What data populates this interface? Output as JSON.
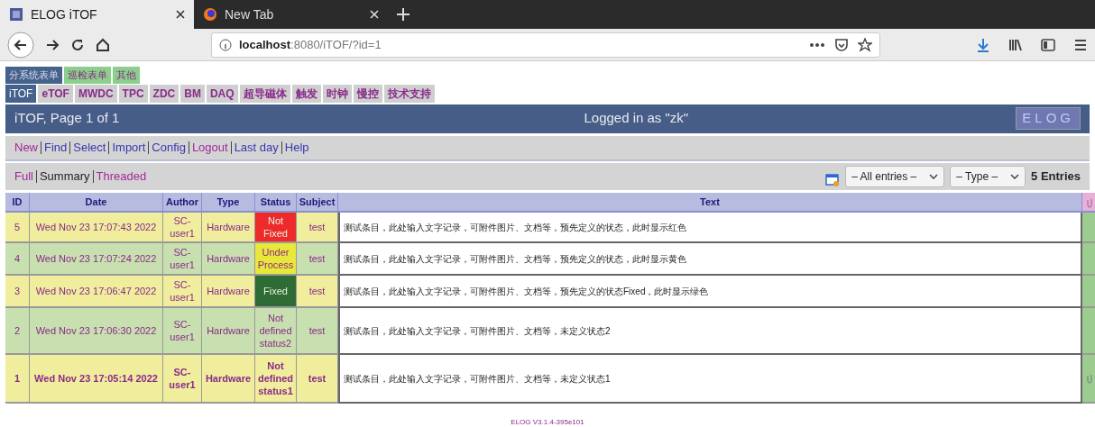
{
  "browser": {
    "tabs": [
      {
        "title": "ELOG iTOF",
        "selected": true
      },
      {
        "title": "New Tab",
        "selected": false
      }
    ],
    "url_host": "localhost",
    "url_rest": ":8080/iTOF/?id=1"
  },
  "group_tabs": [
    {
      "label": "分系统表单",
      "selected": true
    },
    {
      "label": "巡检表单",
      "selected": false
    },
    {
      "label": "其他",
      "selected": false
    }
  ],
  "logbook_tabs": [
    {
      "label": "iTOF",
      "selected": true
    },
    {
      "label": "eTOF",
      "selected": false
    },
    {
      "label": "MWDC",
      "selected": false
    },
    {
      "label": "TPC",
      "selected": false
    },
    {
      "label": "ZDC",
      "selected": false
    },
    {
      "label": "BM",
      "selected": false
    },
    {
      "label": "DAQ",
      "selected": false
    },
    {
      "label": "超导磁体",
      "selected": false
    },
    {
      "label": "触发",
      "selected": false
    },
    {
      "label": "时钟",
      "selected": false
    },
    {
      "label": "慢控",
      "selected": false
    },
    {
      "label": "技术支持",
      "selected": false
    }
  ],
  "title_bar": {
    "title": "iTOF, Page 1 of 1",
    "login": "Logged in as \"zk\"",
    "logo": "ELOG"
  },
  "menu": [
    {
      "label": "New",
      "visited": true
    },
    {
      "label": "Find",
      "visited": false
    },
    {
      "label": "Select",
      "visited": false
    },
    {
      "label": "Import",
      "visited": false
    },
    {
      "label": "Config",
      "visited": false
    },
    {
      "label": "Logout",
      "visited": true
    },
    {
      "label": "Last day",
      "visited": false
    },
    {
      "label": "Help",
      "visited": false
    }
  ],
  "views": [
    {
      "label": "Full",
      "selected": false
    },
    {
      "label": "Summary",
      "selected": true
    },
    {
      "label": "Threaded",
      "selected": false
    }
  ],
  "filters": [
    {
      "value": "– All entries –"
    },
    {
      "value": "– Type –"
    }
  ],
  "entry_count": "5 Entries",
  "table": {
    "columns": [
      "ID",
      "Date",
      "Author",
      "Type",
      "Status",
      "Subject",
      "Text"
    ],
    "rows": [
      {
        "id": "5",
        "date": "Wed Nov 23 17:07:43 2022",
        "author": "SC-user1",
        "type": "Hardware",
        "status": "Not Fixed",
        "color": "#ee2a2a",
        "subject": "test",
        "text": "测试条目，此处输入文字记录，可附件图片、文档等，预先定义的状态，此时显示红色",
        "unread": false,
        "attachment": false
      },
      {
        "id": "4",
        "date": "Wed Nov 23 17:07:24 2022",
        "author": "SC-user1",
        "type": "Hardware",
        "status": "Under Process",
        "color": "#e8e83a",
        "subject": "test",
        "text": "测试条目，此处输入文字记录，可附件图片、文档等，预先定义的状态，此时显示黄色",
        "unread": false,
        "attachment": false
      },
      {
        "id": "3",
        "date": "Wed Nov 23 17:06:47 2022",
        "author": "SC-user1",
        "type": "Hardware",
        "status": "Fixed",
        "color": "#2e6b35",
        "subject": "test",
        "text": "测试条目，此处输入文字记录，可附件图片、文档等，预先定义的状态Fixed，此时显示绿色",
        "unread": false,
        "attachment": false
      },
      {
        "id": "2",
        "date": "Wed Nov 23 17:06:30 2022",
        "author": "SC-user1",
        "type": "Hardware",
        "status": "Not defined status2",
        "subject": "test",
        "text": "测试条目，此处输入文字记录，可附件图片、文档等，未定义状态2",
        "unread": false,
        "attachment": false
      },
      {
        "id": "1",
        "date": "Wed Nov 23 17:05:14 2022",
        "author": "SC-user1",
        "type": "Hardware",
        "status": "Not defined status1",
        "subject": "test",
        "text": "测试条目，此处输入文字记录，可附件图片、文档等，未定义状态1",
        "unread": true,
        "attachment": true
      }
    ]
  },
  "footer": "ELOG V3.1.4-395e101"
}
